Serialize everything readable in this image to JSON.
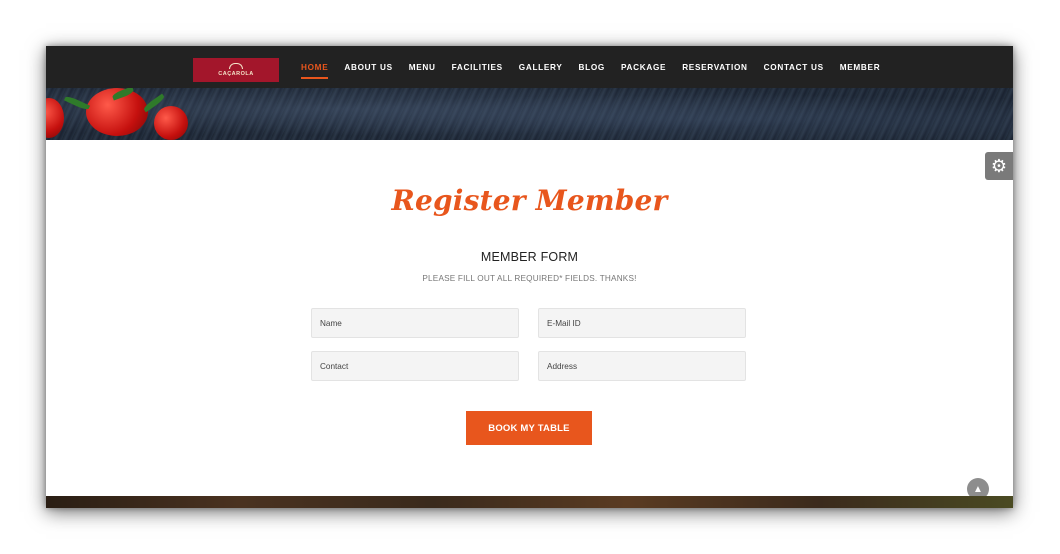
{
  "brand": {
    "logo_text": "CAÇAROLA"
  },
  "nav": {
    "items": [
      {
        "label": "HOME",
        "active": true
      },
      {
        "label": "ABOUT US",
        "active": false
      },
      {
        "label": "MENU",
        "active": false
      },
      {
        "label": "FACILITIES",
        "active": false
      },
      {
        "label": "GALLERY",
        "active": false
      },
      {
        "label": "BLOG",
        "active": false
      },
      {
        "label": "PACKAGE",
        "active": false
      },
      {
        "label": "RESERVATION",
        "active": false
      },
      {
        "label": "CONTACT US",
        "active": false
      },
      {
        "label": "MEMBER",
        "active": false
      }
    ]
  },
  "page": {
    "title": "Register Member",
    "form_heading": "MEMBER FORM",
    "form_subheading": "PLEASE FILL OUT ALL REQUIRED* FIELDS. THANKS!"
  },
  "form": {
    "name": {
      "placeholder": "Name",
      "value": ""
    },
    "email": {
      "placeholder": "E-Mail ID",
      "value": ""
    },
    "contact": {
      "placeholder": "Contact",
      "value": ""
    },
    "address": {
      "placeholder": "Address",
      "value": ""
    },
    "submit_label": "BOOK MY TABLE"
  },
  "icons": {
    "settings": "gear-icon",
    "scroll_top": "chevron-up-icon"
  },
  "colors": {
    "accent": "#e8561d",
    "navbar": "#222222",
    "logo_bg": "#a3162b"
  }
}
